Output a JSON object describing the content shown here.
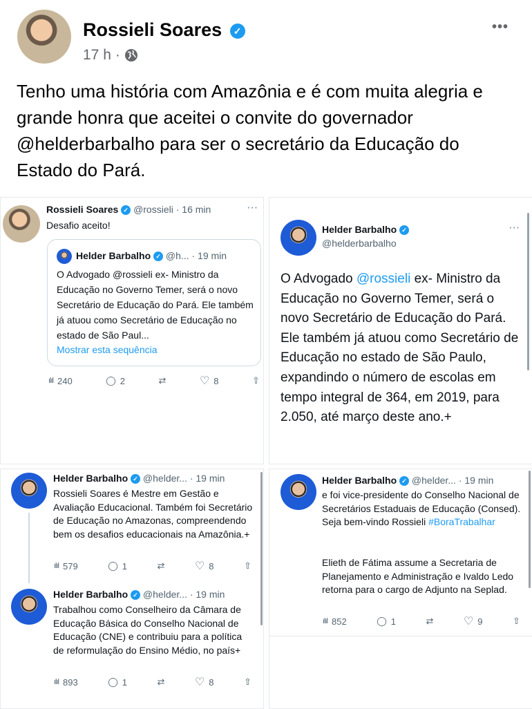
{
  "post": {
    "author": "Rossieli Soares",
    "time": "17 h",
    "separator": "·",
    "more": "•••",
    "text": "Tenho uma história com Amazônia e é com muita alegria e grande honra que aceitei o convite do governador @helderbarbalho para ser o secretário da Educação do Estado do Pará."
  },
  "tweet1": {
    "name": "Rossieli Soares",
    "meta": "@rossieli · 16 min",
    "text": "Desafio aceito!",
    "more": "···",
    "quote": {
      "name": "Helder Barbalho",
      "meta": "@h... · 19 min",
      "text": "O Advogado @rossieli ex- Ministro da Educação no Governo Temer, será o novo Secretário de Educação do Pará. Ele também já atuou como Secretário de Educação no estado de São Paul...",
      "show_thread": "Mostrar esta sequência"
    },
    "stats": {
      "views": "240",
      "replies": "2",
      "retweets": "",
      "likes": "8"
    }
  },
  "tweet2": {
    "name": "Helder Barbalho",
    "handle": "@helderbarbalho",
    "more": "···",
    "text_before": "O Advogado ",
    "mention": "@rossieli",
    "text_after": " ex- Ministro da Educação no Governo Temer, será o novo Secretário de Educação do Pará. Ele também já atuou como Secretário de Educação no estado de São Paulo, expandindo o número de escolas em tempo integral de 364, em 2019, para 2.050, até março deste ano.+"
  },
  "tweet3": {
    "name": "Helder Barbalho",
    "meta": "@helder... · 19 min",
    "more": "···",
    "text": "Rossieli Soares é Mestre em Gestão e Avaliação Educacional. Também foi Secretário de Educação no Amazonas, compreendendo bem os desafios educacionais na Amazônia.+",
    "stats": {
      "views": "579",
      "replies": "1",
      "likes": "8"
    }
  },
  "tweet4": {
    "name": "Helder Barbalho",
    "meta": "@helder... · 19 min",
    "text": "Trabalhou como Conselheiro da Câmara de Educação Básica do Conselho Nacional de Educação (CNE) e contribuiu para a política de reformulação do Ensino Médio, no país+",
    "stats": {
      "views": "893",
      "replies": "1",
      "likes": "8"
    }
  },
  "tweet5": {
    "name": "Helder Barbalho",
    "meta": "@helder... · 19 min",
    "text_before": "e foi vice-presidente do Conselho Nacional de Secretários Estaduais de Educação (Consed). Seja bem-vindo Rossieli ",
    "hashtag": "#BoraTrabalhar",
    "text2": "Elieth de Fátima assume a Secretaria de Planejamento e Administração e Ivaldo Ledo retorna para o cargo de Adjunto na Seplad.",
    "stats": {
      "views": "852",
      "replies": "1",
      "likes": "9"
    }
  },
  "icons": {
    "verified": "✓",
    "globe": "globe-icon",
    "views": "ılıl",
    "reply": "◯",
    "retweet": "⇄",
    "like": "♡",
    "share": "⇧"
  },
  "colors": {
    "link": "#1d9bf0",
    "verified": "#1d9bf0",
    "text": "#0f1419",
    "muted": "#536471"
  }
}
